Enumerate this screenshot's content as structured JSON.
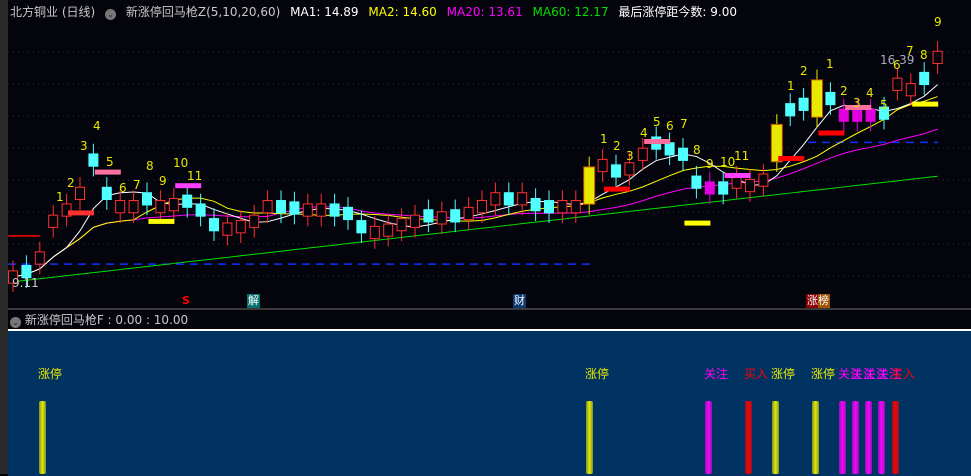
{
  "header": {
    "stock": "北方铜业 (日线)",
    "indicator": "新涨停回马枪Z(5,10,20,60)",
    "ma1": "MA1: 14.89",
    "ma2": "MA2: 14.60",
    "ma20": "MA20: 13.61",
    "ma60": "MA60: 12.17",
    "last": "最后涨停距今数: 9.00"
  },
  "colors": {
    "ma1": "#ffffff",
    "ma2": "#ffff00",
    "ma20": "#ff00ff",
    "ma60": "#00e000",
    "up": "#ff3030",
    "down": "#50ffff",
    "limit": "#e8e800"
  },
  "price_range": [
    8.9,
    16.9
  ],
  "candles": [
    [
      9.34,
      "u"
    ],
    [
      9.5,
      "d"
    ],
    [
      9.9,
      "u"
    ],
    [
      10.98,
      "u"
    ],
    [
      11.31,
      "u"
    ],
    [
      11.8,
      "u"
    ],
    [
      12.78,
      "d"
    ],
    [
      11.8,
      "d"
    ],
    [
      11.41,
      "u"
    ],
    [
      11.41,
      "u"
    ],
    [
      11.64,
      "d"
    ],
    [
      11.41,
      "u"
    ],
    [
      11.47,
      "u"
    ],
    [
      11.57,
      "d"
    ],
    [
      11.31,
      "d"
    ],
    [
      10.88,
      "d"
    ],
    [
      10.75,
      "u"
    ],
    [
      10.82,
      "u"
    ],
    [
      10.98,
      "u"
    ],
    [
      11.41,
      "u"
    ],
    [
      11.41,
      "d"
    ],
    [
      11.37,
      "d"
    ],
    [
      11.31,
      "u"
    ],
    [
      11.31,
      "u"
    ],
    [
      11.31,
      "d"
    ],
    [
      11.21,
      "d"
    ],
    [
      10.82,
      "d"
    ],
    [
      10.65,
      "u"
    ],
    [
      10.72,
      "u"
    ],
    [
      10.88,
      "u"
    ],
    [
      10.98,
      "u"
    ],
    [
      11.14,
      "d"
    ],
    [
      11.08,
      "u"
    ],
    [
      11.14,
      "d"
    ],
    [
      11.21,
      "u"
    ],
    [
      11.41,
      "u"
    ],
    [
      11.64,
      "u"
    ],
    [
      11.64,
      "d"
    ],
    [
      11.64,
      "u"
    ],
    [
      11.47,
      "d"
    ],
    [
      11.41,
      "d"
    ],
    [
      11.41,
      "u"
    ],
    [
      11.41,
      "u"
    ],
    [
      12.03,
      "z"
    ],
    [
      12.62,
      "u"
    ],
    [
      12.46,
      "d"
    ],
    [
      12.52,
      "u"
    ],
    [
      12.95,
      "u"
    ],
    [
      13.28,
      "d"
    ],
    [
      13.11,
      "d"
    ],
    [
      12.95,
      "d"
    ],
    [
      12.13,
      "d"
    ],
    [
      11.96,
      "m"
    ],
    [
      11.96,
      "d"
    ],
    [
      12.13,
      "u"
    ],
    [
      12.03,
      "u"
    ],
    [
      12.19,
      "u"
    ],
    [
      13.28,
      "z"
    ],
    [
      14.26,
      "d"
    ],
    [
      14.42,
      "d"
    ],
    [
      14.59,
      "z"
    ],
    [
      14.59,
      "d"
    ],
    [
      14.1,
      "m"
    ],
    [
      14.1,
      "m"
    ],
    [
      14.1,
      "m"
    ],
    [
      14.16,
      "d"
    ],
    [
      15.01,
      "u"
    ],
    [
      14.85,
      "u"
    ],
    [
      15.18,
      "d"
    ],
    [
      15.8,
      "u"
    ]
  ],
  "price_label": "9.11",
  "high_label": "16.39",
  "labels": [
    "1",
    "2",
    "3",
    "4",
    "5",
    "6",
    "7",
    "8",
    "9",
    "10",
    "11",
    "1",
    "2",
    "3",
    "4",
    "5",
    "6",
    "7",
    "8",
    "9",
    "10",
    "11",
    "1",
    "2",
    "1",
    "2",
    "3",
    "4",
    "5",
    "6",
    "7",
    "8",
    "9"
  ],
  "markers": {
    "s": "S",
    "jie": "解",
    "cai": "财",
    "zhangbang": "涨榜"
  },
  "sub": {
    "title": "新涨停回马枪F : 0.00 : 10.00",
    "signals": [
      {
        "t": "涨停",
        "c": "#e8e800"
      },
      {
        "t": "涨停",
        "c": "#e8e800"
      },
      {
        "t": "关注",
        "c": "#ff00ff"
      },
      {
        "t": "买入",
        "c": "#ff0000"
      },
      {
        "t": "涨停",
        "c": "#e8e800"
      },
      {
        "t": "涨停",
        "c": "#e8e800"
      },
      {
        "t": "关注",
        "c": "#ff00ff"
      },
      {
        "t": "关注",
        "c": "#ff00ff"
      },
      {
        "t": "关注",
        "c": "#ff00ff"
      },
      {
        "t": "关注",
        "c": "#ff00ff"
      },
      {
        "t": "买入",
        "c": "#ff0000"
      }
    ]
  }
}
